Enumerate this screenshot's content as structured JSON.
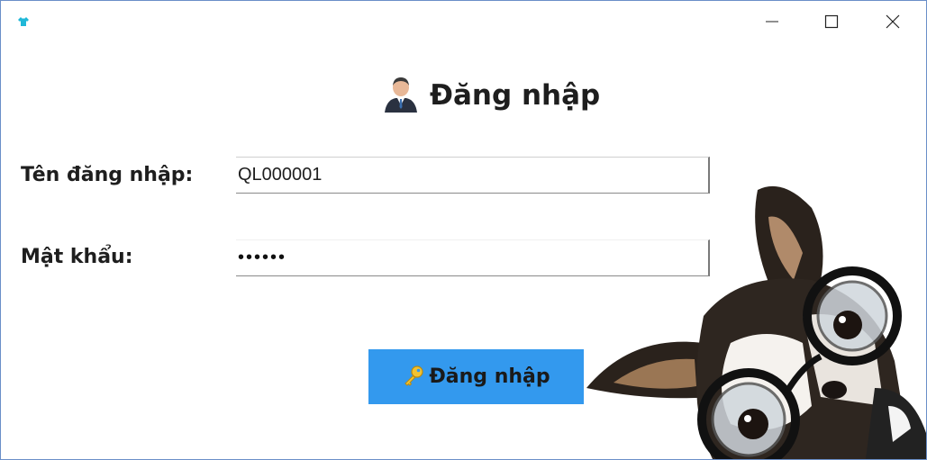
{
  "window": {
    "controls": {
      "minimize_icon": "minimize-icon",
      "maximize_icon": "maximize-icon",
      "close_icon": "close-icon"
    },
    "app_icon": "shirt-icon"
  },
  "header": {
    "title": "Đăng nhập",
    "icon": "user-icon"
  },
  "form": {
    "username_label": "Tên  đăng nhập:",
    "username_value": "QL000001",
    "password_label": "Mật khẩu:",
    "password_value": "••••••"
  },
  "login_button": {
    "label": "Đăng nhập",
    "icon": "key-icon",
    "color": "#3399ee"
  },
  "decoration": {
    "image": "dog-with-glasses"
  }
}
